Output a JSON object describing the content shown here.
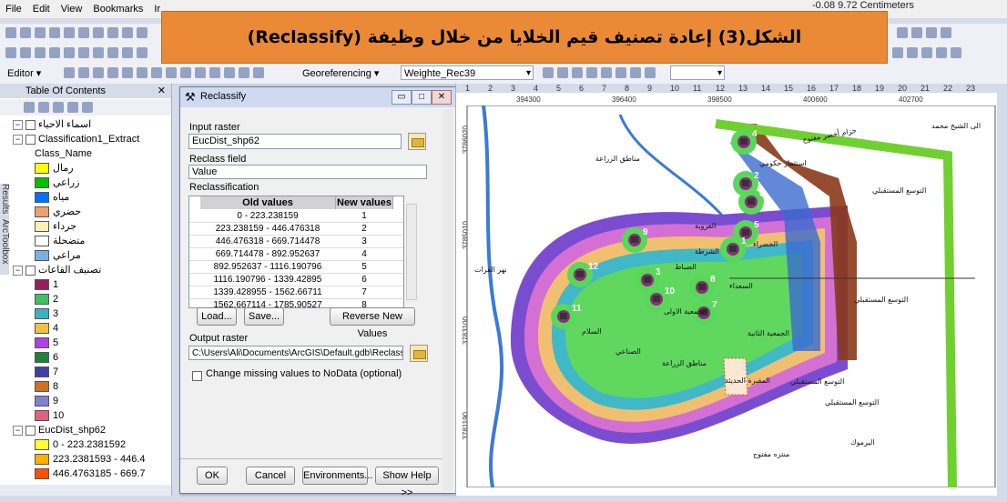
{
  "menu": [
    "File",
    "Edit",
    "View",
    "Bookmarks",
    "Ir"
  ],
  "coord_readout": "-0.08  9.72 Centimeters",
  "banner_title": "الشكل(3) إعادة تصنيف قيم الخلايا من خلال وظيفة (Reclassify)",
  "toolbar3": {
    "editor": "Editor ▾",
    "georeferencing": "Georeferencing ▾",
    "layer": "Weighte_Rec39"
  },
  "toc": {
    "title": "Table Of Contents",
    "side_tabs": [
      "Results",
      "ArcToolbox"
    ],
    "layers": [
      {
        "label": "اسماء الاحياء",
        "type": "layer"
      },
      {
        "label": "Classification1_Extract",
        "type": "layer"
      },
      {
        "label": "Class_Name",
        "type": "field"
      },
      {
        "label": "رمال",
        "color": "#ffff00"
      },
      {
        "label": "زراعي",
        "color": "#00c000"
      },
      {
        "label": "مياه",
        "color": "#0070ff"
      },
      {
        "label": "حضري",
        "color": "#f0a070"
      },
      {
        "label": "جرداء",
        "color": "#fff0b0"
      },
      {
        "label": "متضحلة",
        "color": "#ffffff"
      },
      {
        "label": "مراعي",
        "color": "#7ab0e0"
      },
      {
        "label": "تصنيف القاعات",
        "type": "layer"
      },
      {
        "label": "1",
        "color": "#9b1c5a"
      },
      {
        "label": "2",
        "color": "#40c060"
      },
      {
        "label": "3",
        "color": "#40b0c0"
      },
      {
        "label": "4",
        "color": "#f0c040"
      },
      {
        "label": "5",
        "color": "#b040e0"
      },
      {
        "label": "6",
        "color": "#208040"
      },
      {
        "label": "7",
        "color": "#4040a0"
      },
      {
        "label": "8",
        "color": "#d07020"
      },
      {
        "label": "9",
        "color": "#8080d0"
      },
      {
        "label": "10",
        "color": "#e06080"
      },
      {
        "label": "EucDist_shp62",
        "type": "layer"
      },
      {
        "label": "0 - 223.2381592",
        "color": "#ffff30"
      },
      {
        "label": "223.2381593 - 446.4",
        "color": "#ffb000"
      },
      {
        "label": "446.4763185 - 669.7",
        "color": "#ff5000"
      }
    ]
  },
  "dialog": {
    "title": "Reclassify",
    "input_raster_label": "Input raster",
    "input_raster": "EucDist_shp62",
    "reclass_field_label": "Reclass field",
    "reclass_field": "Value",
    "reclassification_label": "Reclassification",
    "col_old": "Old values",
    "col_new": "New values",
    "rows": [
      {
        "old": "0 - 223.238159",
        "new": "1"
      },
      {
        "old": "223.238159 - 446.476318",
        "new": "2"
      },
      {
        "old": "446.476318 - 669.714478",
        "new": "3"
      },
      {
        "old": "669.714478 - 892.952637",
        "new": "4"
      },
      {
        "old": "892.952637 - 1116.190796",
        "new": "5"
      },
      {
        "old": "1116.190796 - 1339.42895",
        "new": "6"
      },
      {
        "old": "1339.428955 - 1562.66711",
        "new": "7"
      },
      {
        "old": "1562.667114 - 1785.90527",
        "new": "8"
      }
    ],
    "load_btn": "Load...",
    "save_btn": "Save...",
    "reverse_btn": "Reverse New Values",
    "output_raster_label": "Output raster",
    "output_raster": "C:\\Users\\Ali\\Documents\\ArcGIS\\Default.gdb\\Reclass_Euc",
    "nodata_label": "Change missing values to NoData (optional)",
    "ok": "OK",
    "cancel": "Cancel",
    "env": "Environments...",
    "help": "Show Help >>"
  },
  "map": {
    "ruler": [
      "1",
      "2",
      "3",
      "4",
      "5",
      "6",
      "7",
      "8",
      "9",
      "10",
      "11",
      "12",
      "13",
      "14",
      "15",
      "16",
      "17",
      "18",
      "19",
      "20",
      "21",
      "22",
      "23"
    ],
    "x_labels": [
      "394300",
      "396400",
      "398500",
      "400600",
      "402700"
    ],
    "y_labels": [
      "3786020",
      "3785010",
      "3783100",
      "3781190"
    ],
    "numbers": [
      "4",
      "2",
      "6",
      "5",
      "9",
      "1",
      "3",
      "8",
      "7",
      "10",
      "12",
      "11"
    ],
    "labels": {
      "l1": "التوسع المستقبلي",
      "l2": "التوسع المستقبلي",
      "l3": "التوسع المستقبلي",
      "l4": "التوسع المستقبلي",
      "l5": "مناطق الزراعة",
      "l6": "مناطق الزراعة",
      "l7": "الصناعي",
      "l8": "المقبرة الحديثة",
      "l9": "اليرموك",
      "l10": "منتزه مفتوح",
      "l11": "استثمار حكومي",
      "l12": "حزام أخضر مفتوح",
      "l13": "الى الشيخ محمد",
      "l14": "نهر الفرات",
      "l15": "الجمعية الاولى",
      "l16": "الجمعية الثانية",
      "l17": "العروبة",
      "l18": "الشرطة",
      "l19": "الخضراء",
      "l20": "السلام",
      "l21": "الضباط",
      "l22": "السعداء"
    }
  }
}
